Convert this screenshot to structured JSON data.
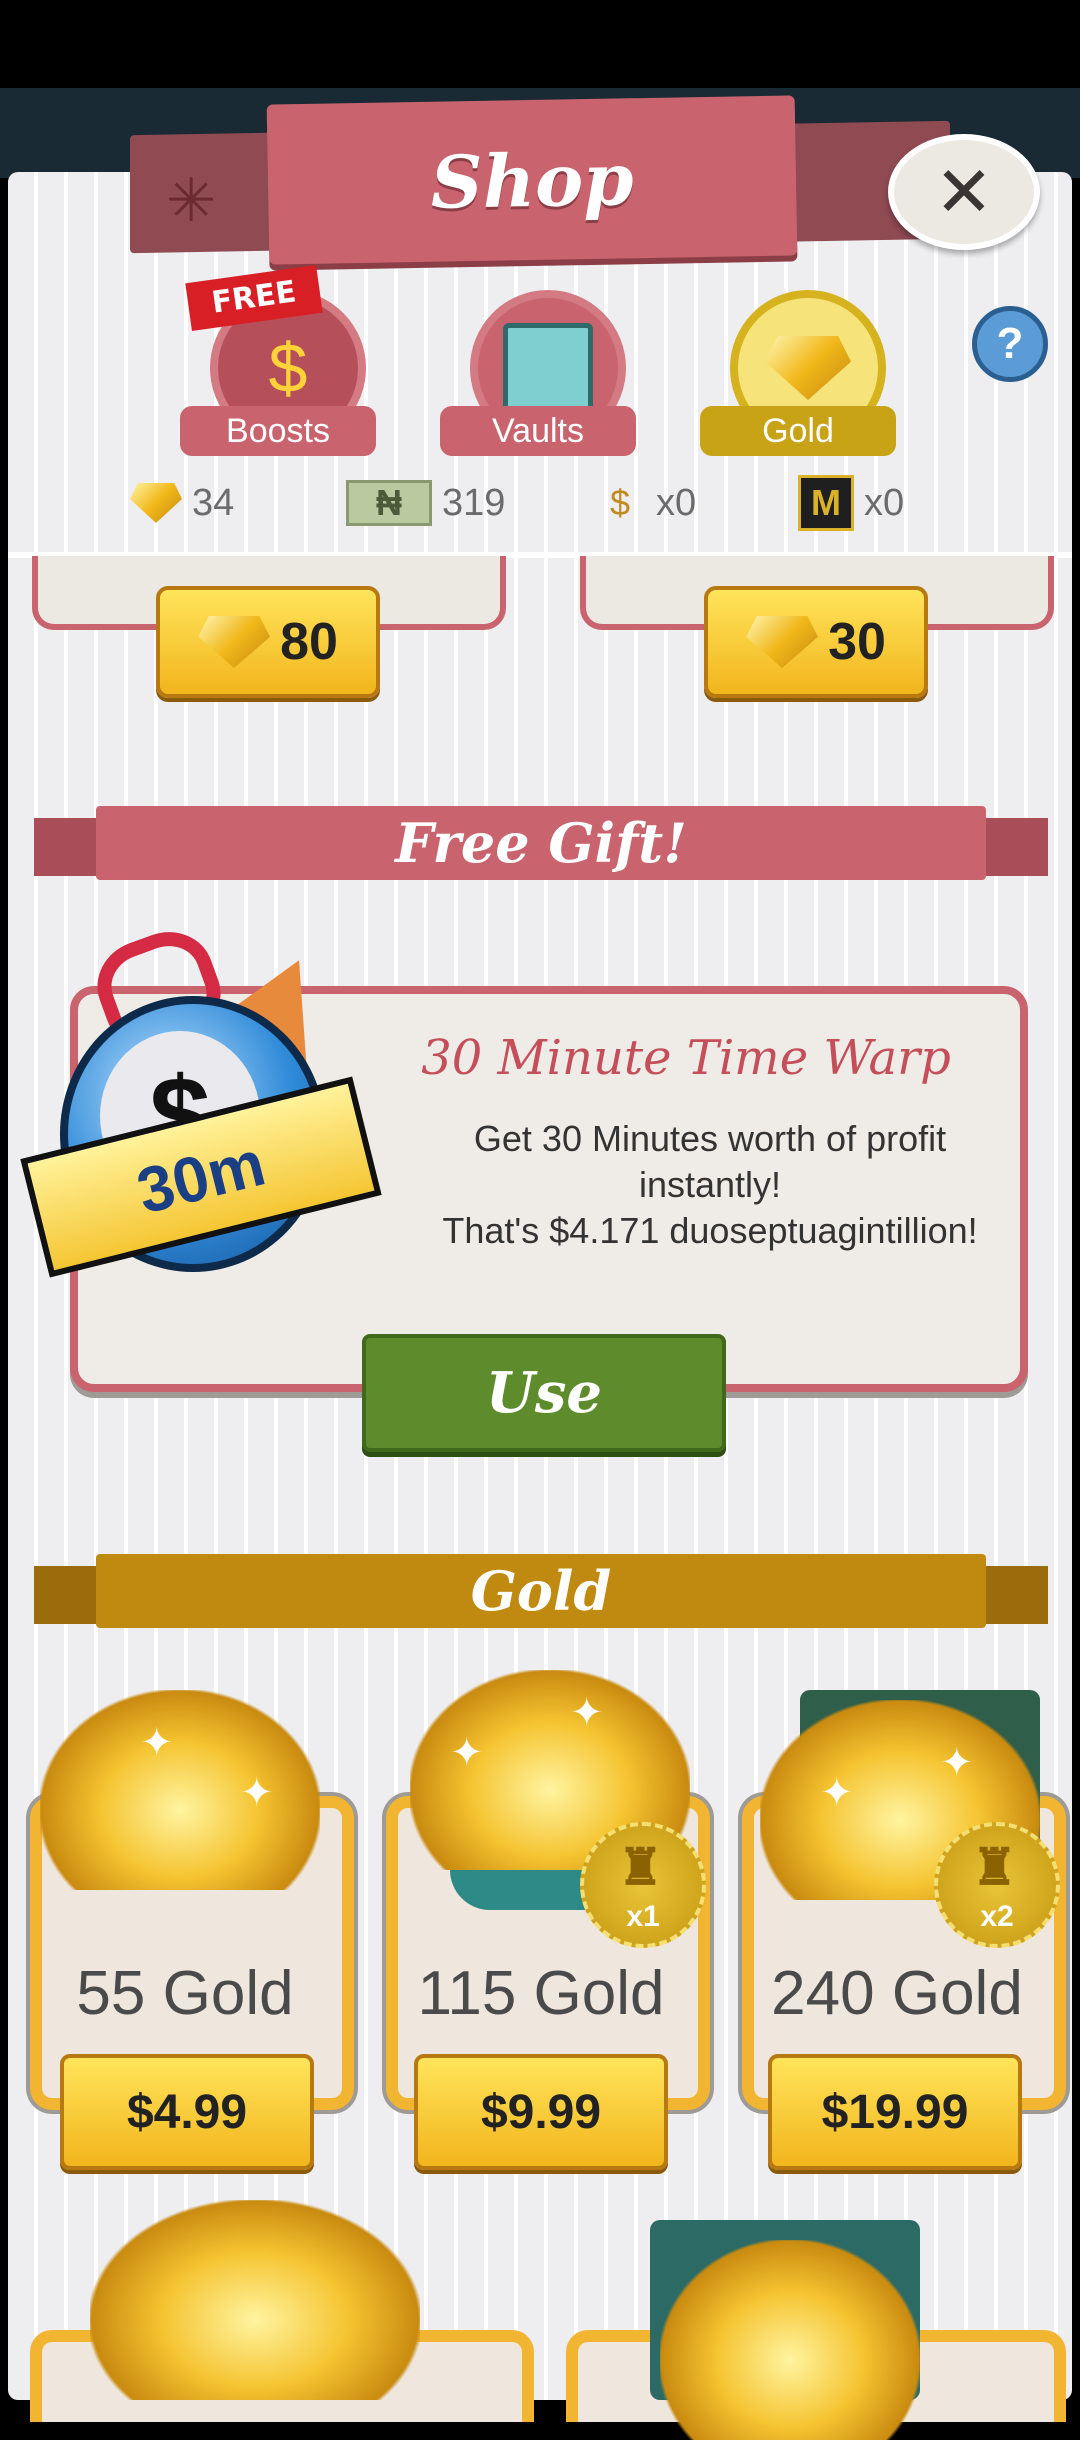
{
  "header": {
    "title": "Shop",
    "close_icon": "✕"
  },
  "tabs": [
    {
      "label": "Boosts",
      "icon": "moneybag-icon",
      "color": "#c9646e",
      "badge": "FREE"
    },
    {
      "label": "Vaults",
      "icon": "vault-icon",
      "color": "#c9646e"
    },
    {
      "label": "Gold",
      "icon": "gold-icon",
      "color": "#c9a316",
      "active": true
    }
  ],
  "help": {
    "label": "?"
  },
  "currencies": [
    {
      "icon": "gold-gem-icon",
      "value": "34"
    },
    {
      "icon": "megabuck-bill-icon",
      "value": "319"
    },
    {
      "icon": "money-bag-icon",
      "value": "x0"
    },
    {
      "icon": "mega-ticket-icon",
      "value": "x0"
    }
  ],
  "top_prices": [
    {
      "value": "80"
    },
    {
      "value": "30"
    }
  ],
  "free_gift": {
    "section_title": "Free Gift!",
    "item_title": "30 Minute Time Warp",
    "banner_text": "30m",
    "description_line1": "Get 30 Minutes worth of profit",
    "description_line2": "instantly!",
    "description_line3": "That's $4.171 duoseptuagintillion!",
    "button_label": "Use"
  },
  "gold_section": {
    "title": "Gold",
    "items": [
      {
        "label": "55 Gold",
        "price": "$4.99",
        "multiplier": ""
      },
      {
        "label": "115 Gold",
        "price": "$9.99",
        "multiplier": "x1"
      },
      {
        "label": "240 Gold",
        "price": "$19.99",
        "multiplier": "x2"
      }
    ]
  },
  "colors": {
    "pink": "#c9646e",
    "gold": "#c08a10",
    "green": "#5e8c2c",
    "price_yellow": "#f7cd2b"
  }
}
